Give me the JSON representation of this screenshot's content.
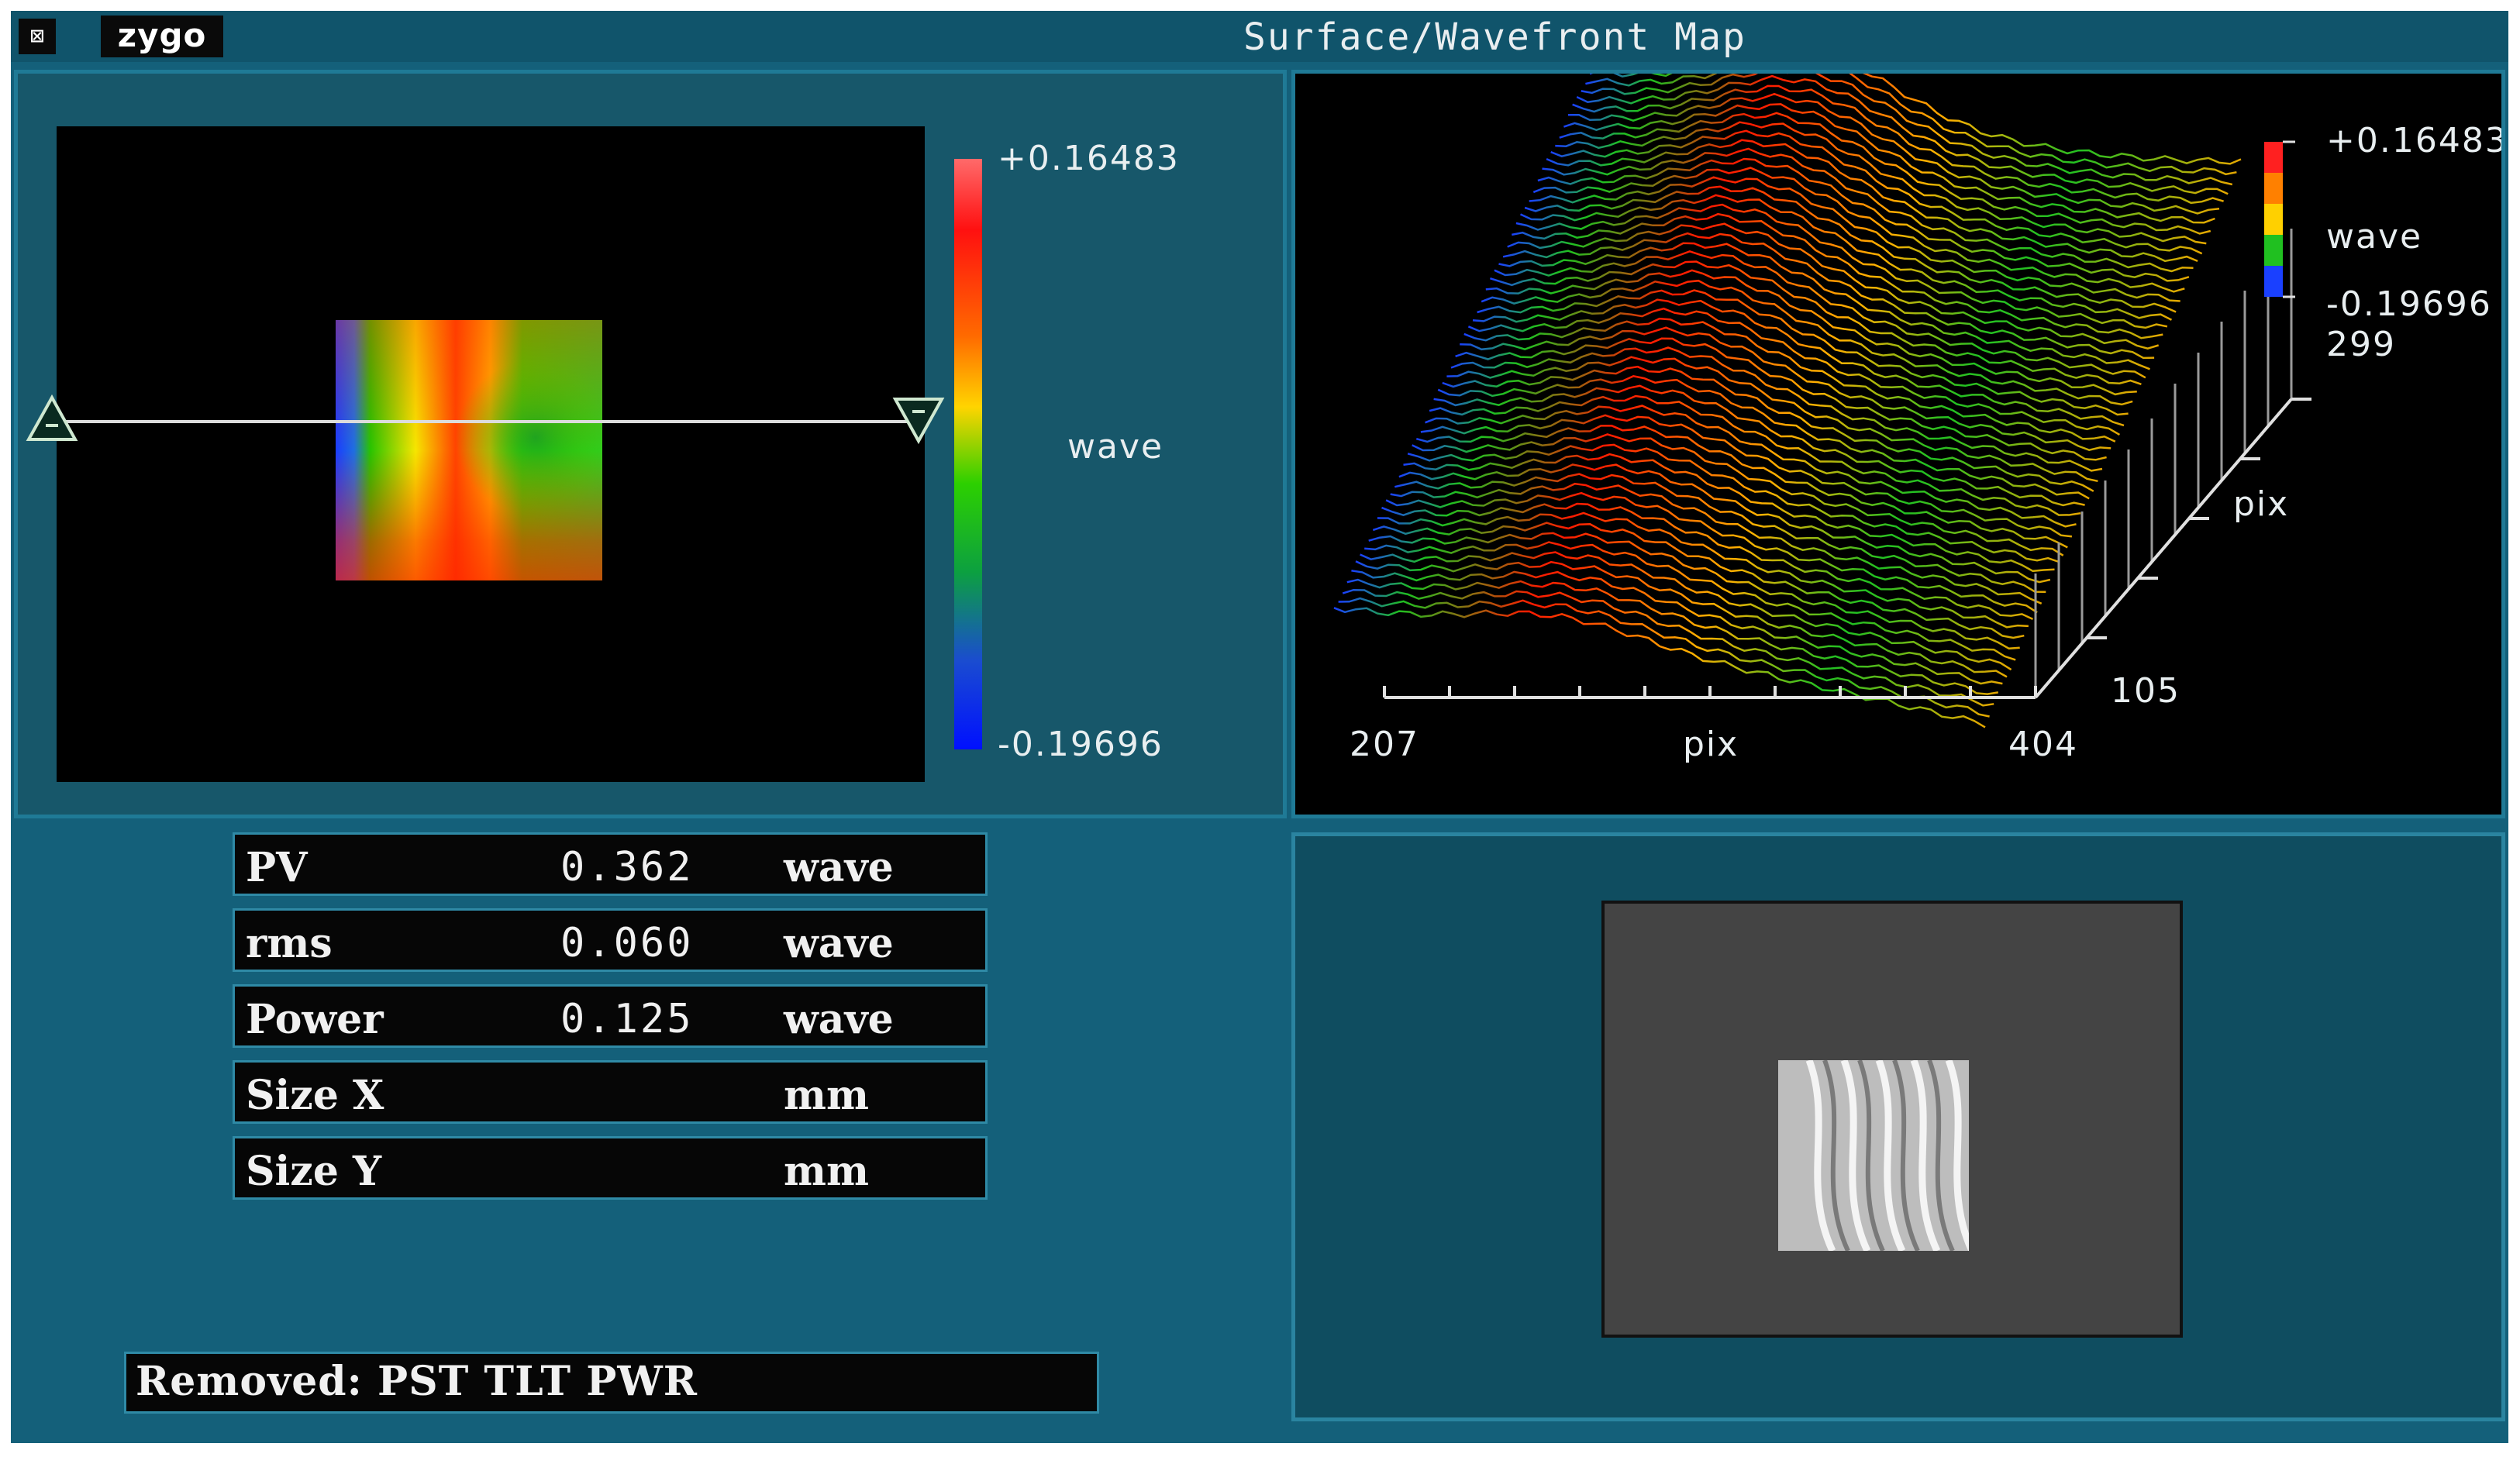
{
  "window": {
    "sys_menu_icon": "⊠",
    "logo": "zygo",
    "title": "Surface/Wavefront Map"
  },
  "map_panel": {
    "scale_max": "+0.16483",
    "scale_min": "-0.19696",
    "unit": "wave"
  },
  "plot3d": {
    "scale_max": "+0.16483",
    "scale_min": "-0.19696",
    "unit": "wave",
    "x_min": "207",
    "x_max": "404",
    "x_label": "pix",
    "y_min": "105",
    "y_max": "299",
    "y_label": "pix"
  },
  "stats": [
    {
      "name": "PV",
      "value": "0.362",
      "unit": "wave"
    },
    {
      "name": "rms",
      "value": "0.060",
      "unit": "wave"
    },
    {
      "name": "Power",
      "value": "0.125",
      "unit": "wave"
    },
    {
      "name": "Size X",
      "value": "",
      "unit": "mm"
    },
    {
      "name": "Size Y",
      "value": "",
      "unit": "mm"
    }
  ],
  "removed": "Removed: PST TLT PWR",
  "colors": {
    "window_bg": "#14607a",
    "title_bg": "#10546b",
    "panel_border": "#1f7a96",
    "accent_red": "#ff1010",
    "accent_green": "#2cd000",
    "accent_blue": "#0010ff"
  }
}
